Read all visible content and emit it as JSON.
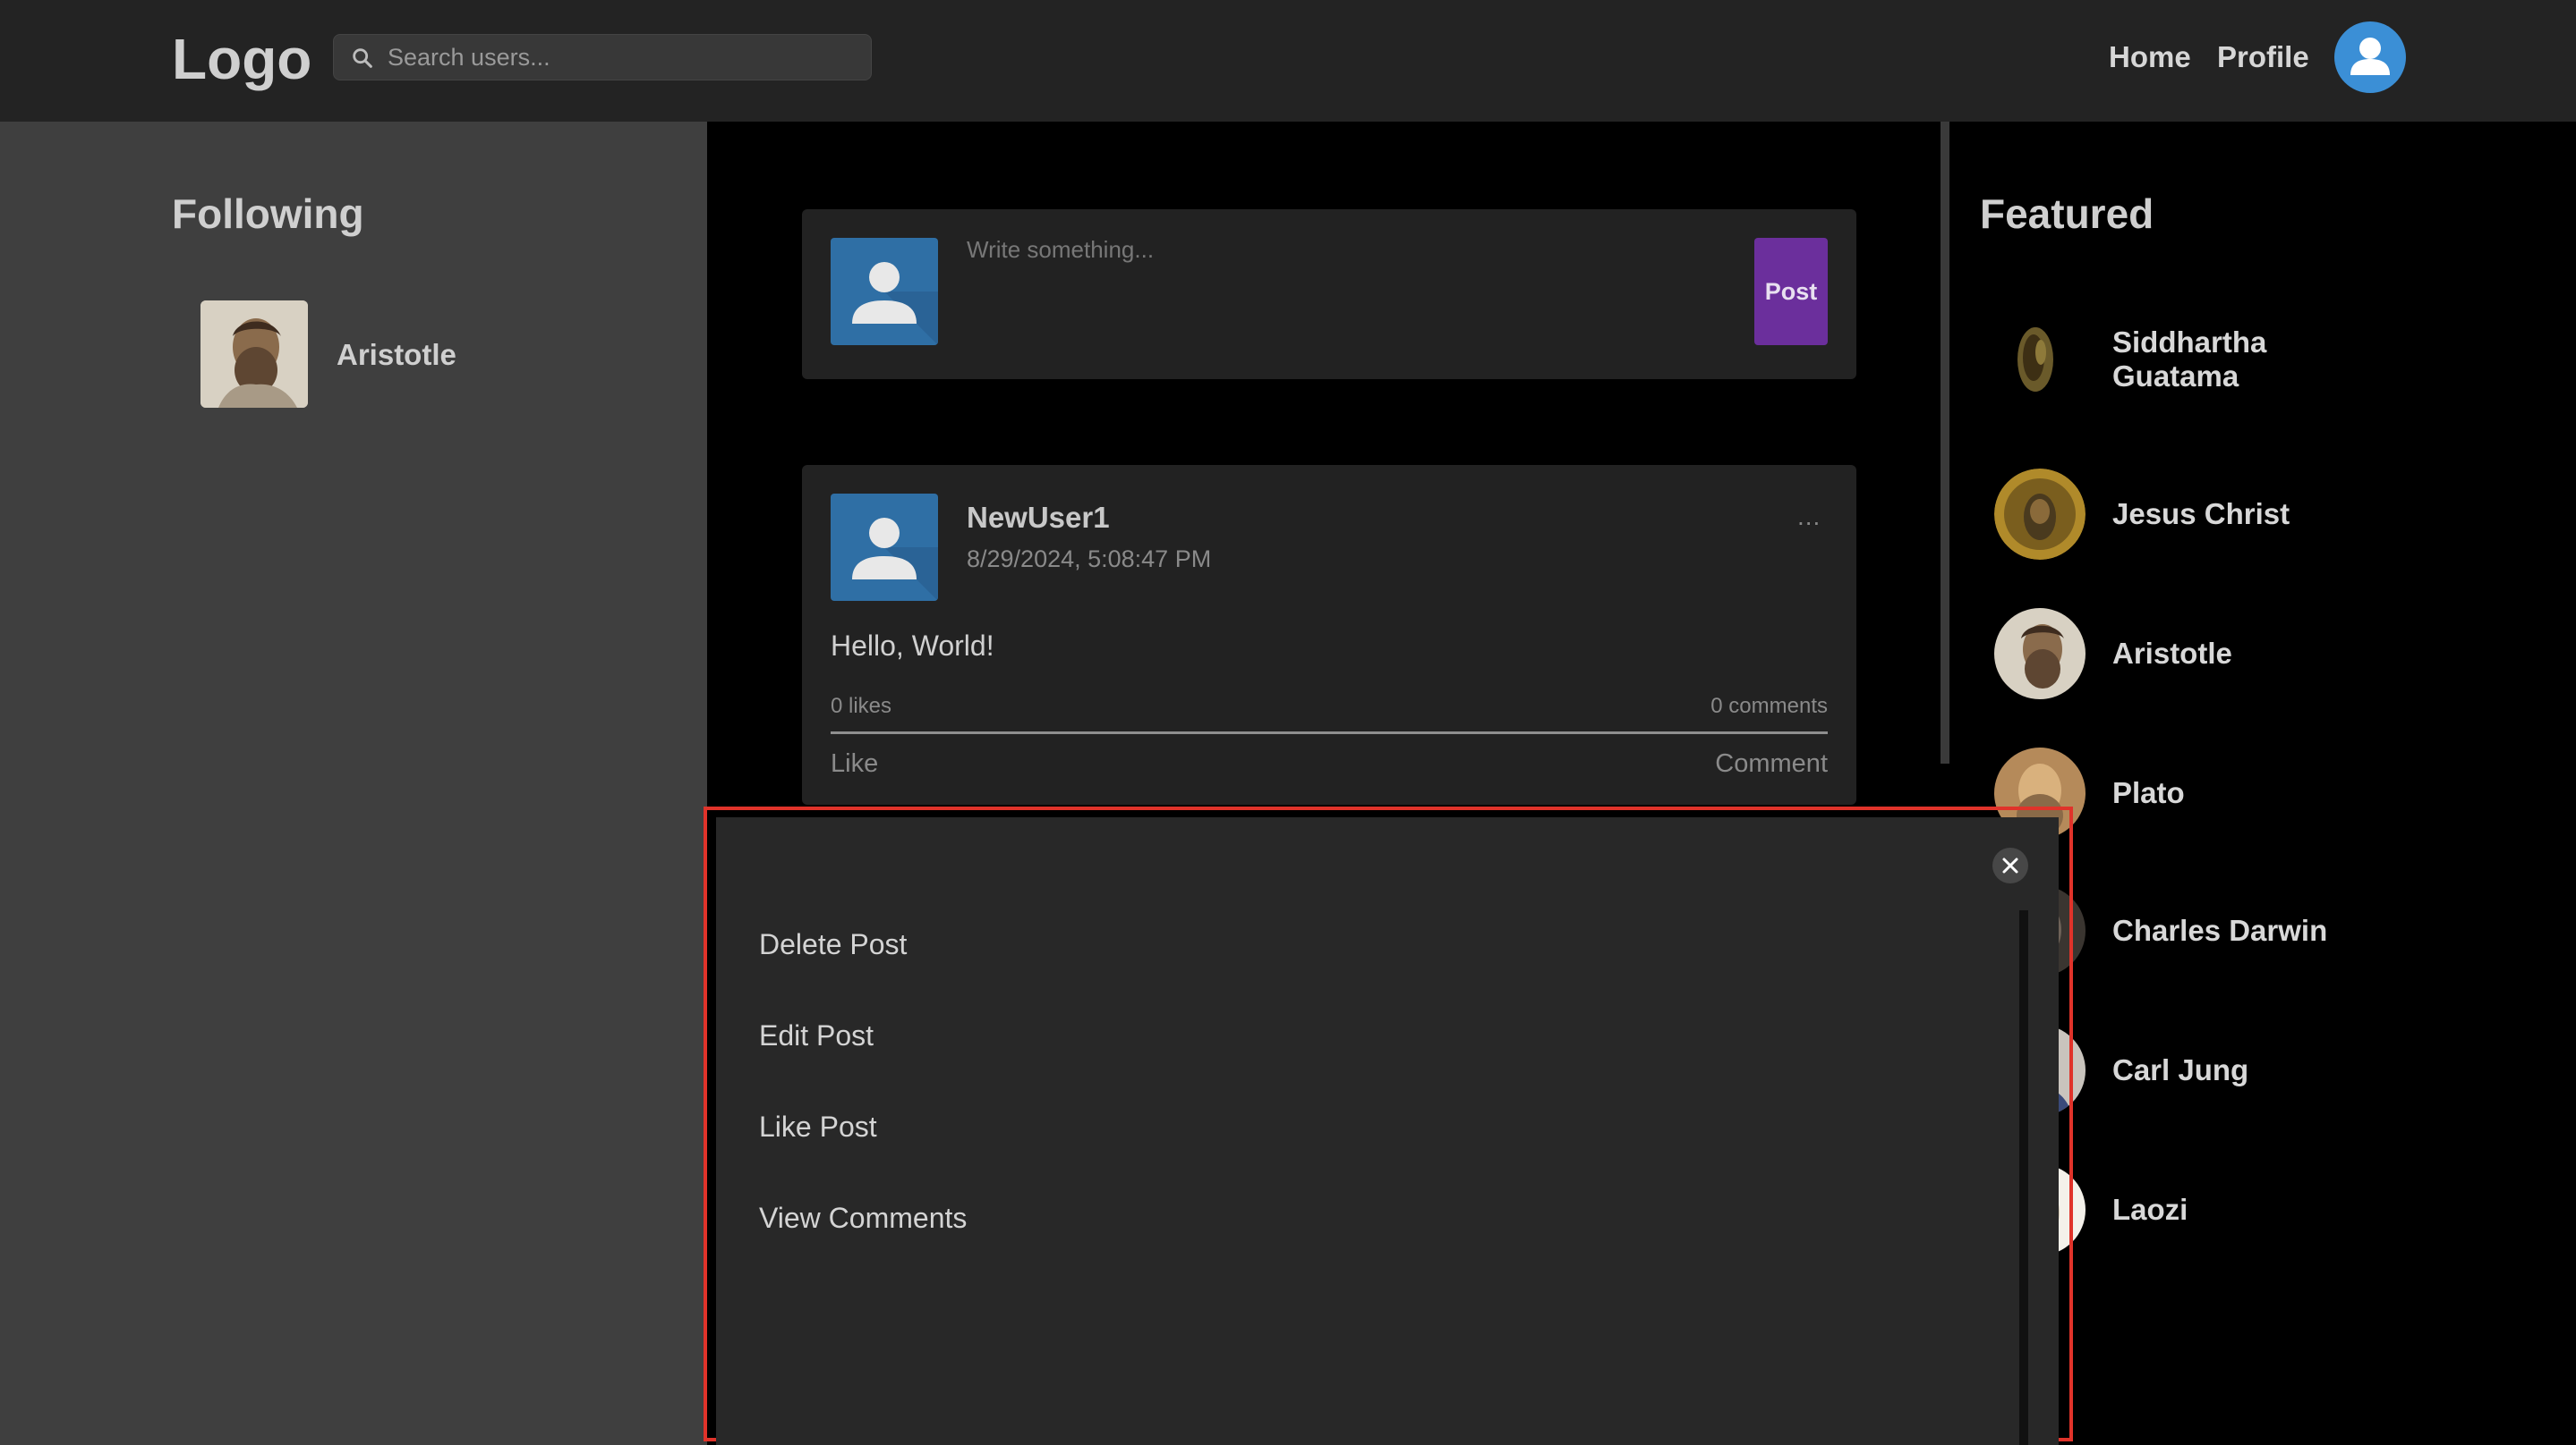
{
  "header": {
    "logo": "Logo",
    "search": {
      "placeholder": "Search users..."
    },
    "nav": {
      "home": "Home",
      "profile": "Profile"
    }
  },
  "left_sidebar": {
    "title": "Following",
    "items": [
      {
        "name": "Aristotle"
      }
    ]
  },
  "composer": {
    "placeholder": "Write something...",
    "post_label": "Post"
  },
  "post": {
    "author": "NewUser1",
    "timestamp": "8/29/2024, 5:08:47 PM",
    "body": "Hello, World!",
    "likes": "0 likes",
    "comments": "0 comments",
    "more_label": "...",
    "like_label": "Like",
    "comment_label": "Comment"
  },
  "featured": {
    "title": "Featured",
    "items": [
      {
        "name_line1": "Siddhartha",
        "name_line2": "Guatama"
      },
      {
        "name": "Jesus Christ"
      },
      {
        "name": "Aristotle"
      },
      {
        "name": "Plato"
      },
      {
        "name": "Charles Darwin"
      },
      {
        "name": "Carl Jung"
      },
      {
        "name": "Laozi"
      }
    ]
  },
  "modal": {
    "close_icon": "close-icon",
    "options": [
      "Delete Post",
      "Edit Post",
      "Like Post",
      "View Comments"
    ]
  },
  "colors": {
    "topbar": "#232323",
    "sidebar": "#3f3f3f",
    "feed_bg": "#000000",
    "card": "#222222",
    "post_button": "#6b2f9c",
    "avatar_blue": "#2f6fa5",
    "highlight": "#e0332a"
  }
}
